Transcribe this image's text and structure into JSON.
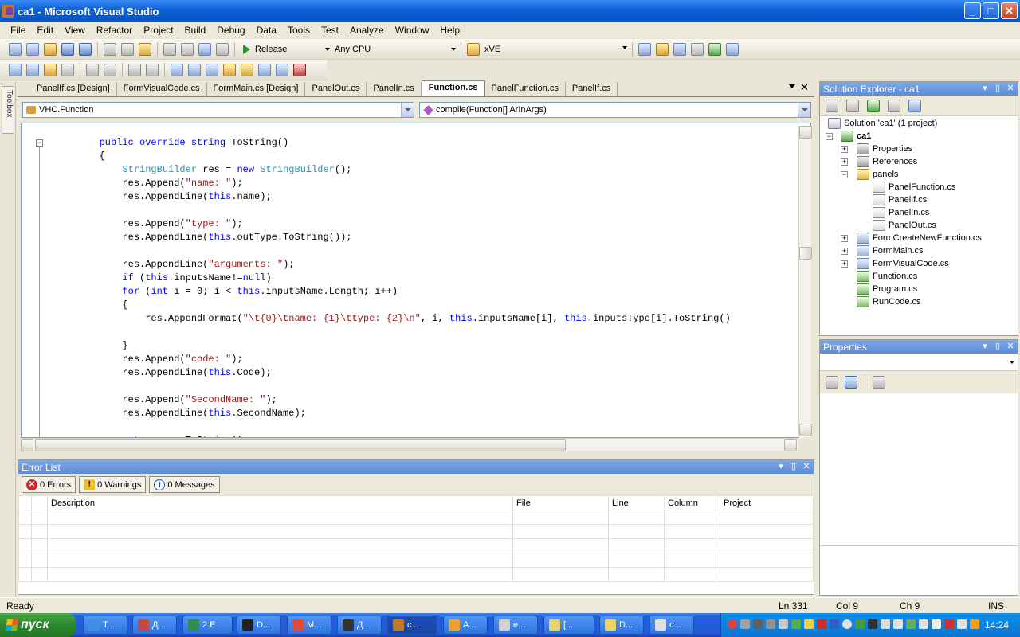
{
  "window": {
    "title": "ca1 - Microsoft Visual Studio",
    "min": "_",
    "max": "□",
    "close": "✕"
  },
  "menu": [
    "File",
    "Edit",
    "View",
    "Refactor",
    "Project",
    "Build",
    "Debug",
    "Data",
    "Tools",
    "Test",
    "Analyze",
    "Window",
    "Help"
  ],
  "toolbar": {
    "config": "Release",
    "platform": "Any CPU",
    "find_combo": "xVE"
  },
  "toolbox_label": "Toolbox",
  "doc_tabs": [
    "PanelIf.cs [Design]",
    "FormVisualCode.cs",
    "FormMain.cs [Design]",
    "PanelOut.cs",
    "PanelIn.cs",
    "Function.cs",
    "PanelFunction.cs",
    "PanelIf.cs"
  ],
  "active_tab": "Function.cs",
  "nav": {
    "type": "VHC.Function",
    "member": "compile(Function[] ArInArgs)"
  },
  "solution_explorer": {
    "title": "Solution Explorer - ca1",
    "nodes": [
      "Solution 'ca1' (1 project)",
      "ca1",
      "Properties",
      "References",
      "panels",
      "PanelFunction.cs",
      "PanelIf.cs",
      "PanelIn.cs",
      "PanelOut.cs",
      "FormCreateNewFunction.cs",
      "FormMain.cs",
      "FormVisualCode.cs",
      "Function.cs",
      "Program.cs",
      "RunCode.cs"
    ]
  },
  "properties": {
    "title": "Properties"
  },
  "error_list": {
    "title": "Error List",
    "errors": "0 Errors",
    "warnings": "0 Warnings",
    "messages": "0 Messages",
    "columns": [
      "Description",
      "File",
      "Line",
      "Column",
      "Project"
    ]
  },
  "status": {
    "ready": "Ready",
    "ln": "Ln 331",
    "col": "Col 9",
    "ch": "Ch 9",
    "ins": "INS"
  },
  "taskbar": {
    "start": "пуск",
    "clock": "14:24",
    "tasks": [
      "T...",
      "Д...",
      "2 E",
      "D...",
      "M...",
      "Д...",
      "c...",
      "A...",
      "e...",
      "[...",
      "D...",
      "c..."
    ]
  }
}
